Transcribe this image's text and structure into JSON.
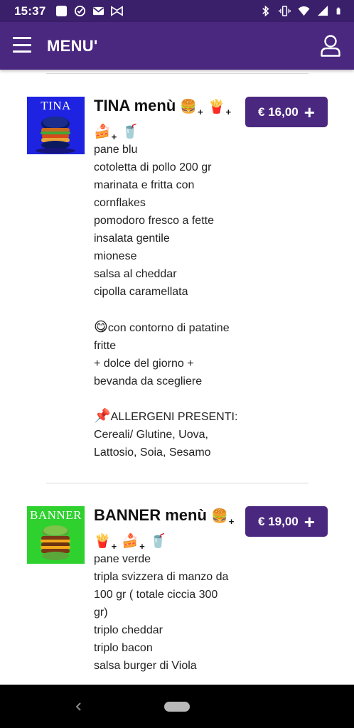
{
  "status_bar": {
    "time": "15:37",
    "left_icons": [
      "square-notification-icon",
      "check-circle-icon",
      "mail-icon",
      "bowtie-icon"
    ],
    "right_icons": [
      "bluetooth-icon",
      "vibrate-icon",
      "wifi-icon",
      "signal-icon",
      "battery-icon"
    ]
  },
  "app_bar": {
    "title": "MENU'"
  },
  "items": [
    {
      "thumb_label": "TINA",
      "thumb_bg": "#1d23e0",
      "title": "TINA menù",
      "price": "€ 16,00",
      "description": "pane blu\ncotoletta di pollo 200 gr\nmarinata e fritta con\ncornflakes\npomodoro fresco a fette\ninsalata gentile\nmionese\nsalsa al cheddar\ncipolla caramellata",
      "extras_emoji": "😋",
      "extras": "con contorno di patatine\nfritte\n+ dolce del giorno +\nbevanda da scegliere",
      "allergens_emoji": "📌",
      "allergens": "ALLERGENI PRESENTI:\nCereali/ Glutine, Uova,\nLattosio, Soia, Sesamo"
    },
    {
      "thumb_label": "BANNER",
      "thumb_bg": "#2fd12f",
      "title": "BANNER menù",
      "price": "€ 19,00",
      "description": "pane verde\ntripla svizzera di manzo da\n100 gr ( totale ciccia 300\ngr)\ntriplo cheddar\ntriplo bacon\nsalsa burger di Viola"
    }
  ],
  "emoji": {
    "burger": "🍔",
    "fries": "🍟",
    "cake": "🍰",
    "drink": "🥤",
    "plus": "+"
  },
  "colors": {
    "status_bar": "#3a1f6b",
    "app_bar": "#4b2880",
    "price_button": "#4b2880"
  }
}
